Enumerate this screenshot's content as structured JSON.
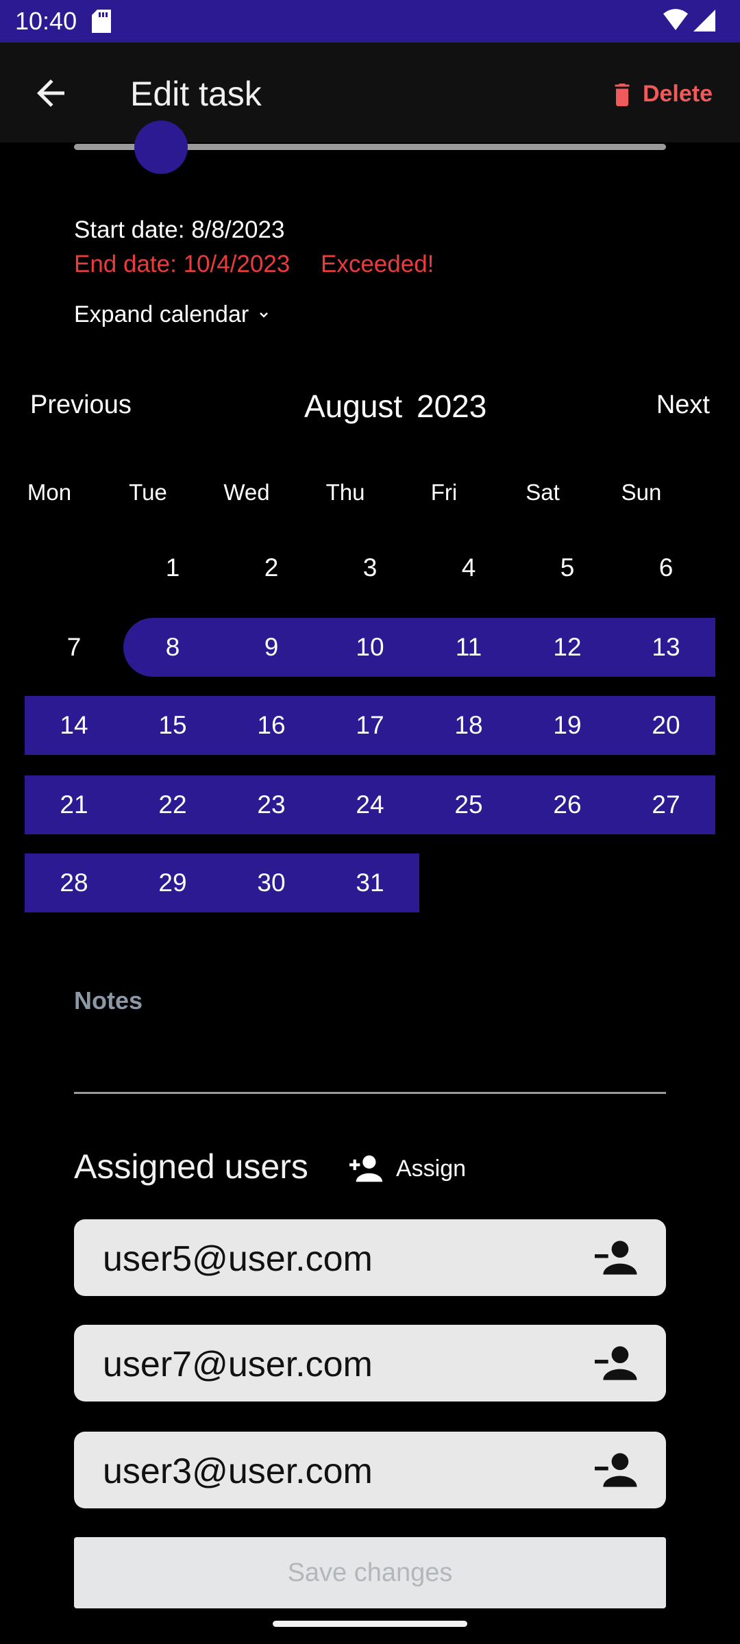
{
  "status_bar": {
    "time": "10:40"
  },
  "app_bar": {
    "title": "Edit task",
    "delete_label": "Delete"
  },
  "dates": {
    "start": "Start date: 8/8/2023",
    "end": "End date: 10/4/2023",
    "exceeded": "Exceeded!",
    "expand_calendar": "Expand calendar"
  },
  "calendar": {
    "prev_label": "Previous",
    "next_label": "Next",
    "month": "August",
    "year": "2023",
    "weekdays": [
      "Mon",
      "Tue",
      "Wed",
      "Thu",
      "Fri",
      "Sat",
      "Sun"
    ],
    "weeks": [
      [
        "",
        "1",
        "2",
        "3",
        "4",
        "5",
        "6"
      ],
      [
        "7",
        "8",
        "9",
        "10",
        "11",
        "12",
        "13"
      ],
      [
        "14",
        "15",
        "16",
        "17",
        "18",
        "19",
        "20"
      ],
      [
        "21",
        "22",
        "23",
        "24",
        "25",
        "26",
        "27"
      ],
      [
        "28",
        "29",
        "30",
        "31",
        "",
        "",
        ""
      ]
    ],
    "selected_range": {
      "start": 8,
      "end": 31
    }
  },
  "notes": {
    "label": "Notes",
    "value": ""
  },
  "assigned": {
    "title": "Assigned users",
    "assign_label": "Assign",
    "users": [
      "user5@user.com",
      "user7@user.com",
      "user3@user.com"
    ]
  },
  "save_label": "Save changes",
  "colors": {
    "accent": "#2c1a93",
    "error": "#ec3b3b",
    "delete": "#ef5b5b"
  }
}
